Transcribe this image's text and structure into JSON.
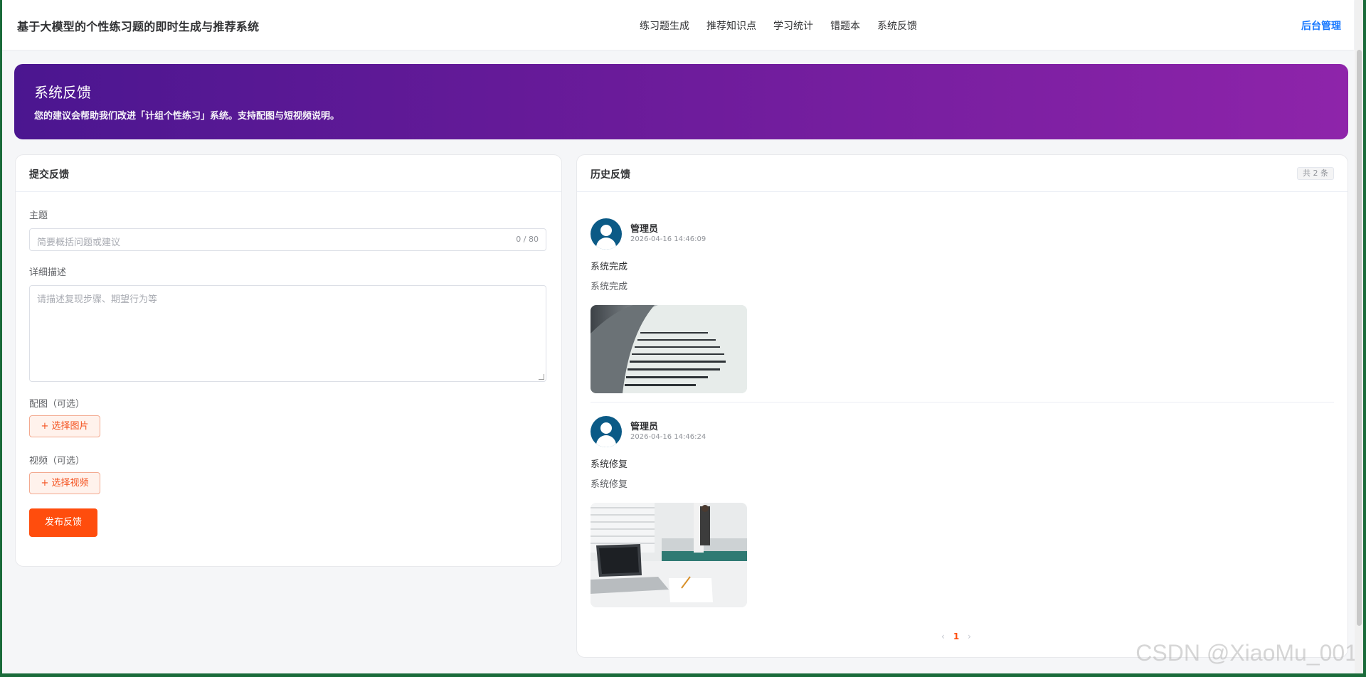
{
  "header": {
    "brand": "基于大模型的个性练习题的即时生成与推荐系统",
    "nav": [
      "练习题生成",
      "推荐知识点",
      "学习统计",
      "错题本",
      "系统反馈"
    ],
    "admin": "后台管理"
  },
  "banner": {
    "title": "系统反馈",
    "subtitle": "您的建议会帮助我们改进「计组个性练习」系统。支持配图与短视频说明。"
  },
  "submit": {
    "title": "提交反馈",
    "subject_label": "主题",
    "subject_placeholder": "简要概括问题或建议",
    "subject_count": "0 / 80",
    "desc_label": "详细描述",
    "desc_placeholder": "请描述复现步骤、期望行为等",
    "image_label": "配图（可选）",
    "image_button": "+ 选择图片",
    "video_label": "视频（可选）",
    "video_button": "+ 选择视频",
    "submit_button": "发布反馈"
  },
  "history": {
    "title": "历史反馈",
    "count": "共 2 条",
    "items": [
      {
        "user": "管理员",
        "time": "2026-04-16 14:46:09",
        "subject": "系统完成",
        "desc": "系统完成",
        "photo": "book-page-photo"
      },
      {
        "user": "管理员",
        "time": "2026-04-16 14:46:24",
        "subject": "系统修复",
        "desc": "系统修复",
        "photo": "classroom-laptop-photo"
      }
    ],
    "pager": {
      "prev": "‹",
      "page": "1",
      "next": "›"
    }
  },
  "watermark": "CSDN @XiaoMu_001",
  "colors": {
    "accent": "#ff4d0d",
    "link": "#1677ff",
    "banner_start": "#4b1690",
    "banner_end": "#8e24aa",
    "avatar": "#0b5a86"
  }
}
